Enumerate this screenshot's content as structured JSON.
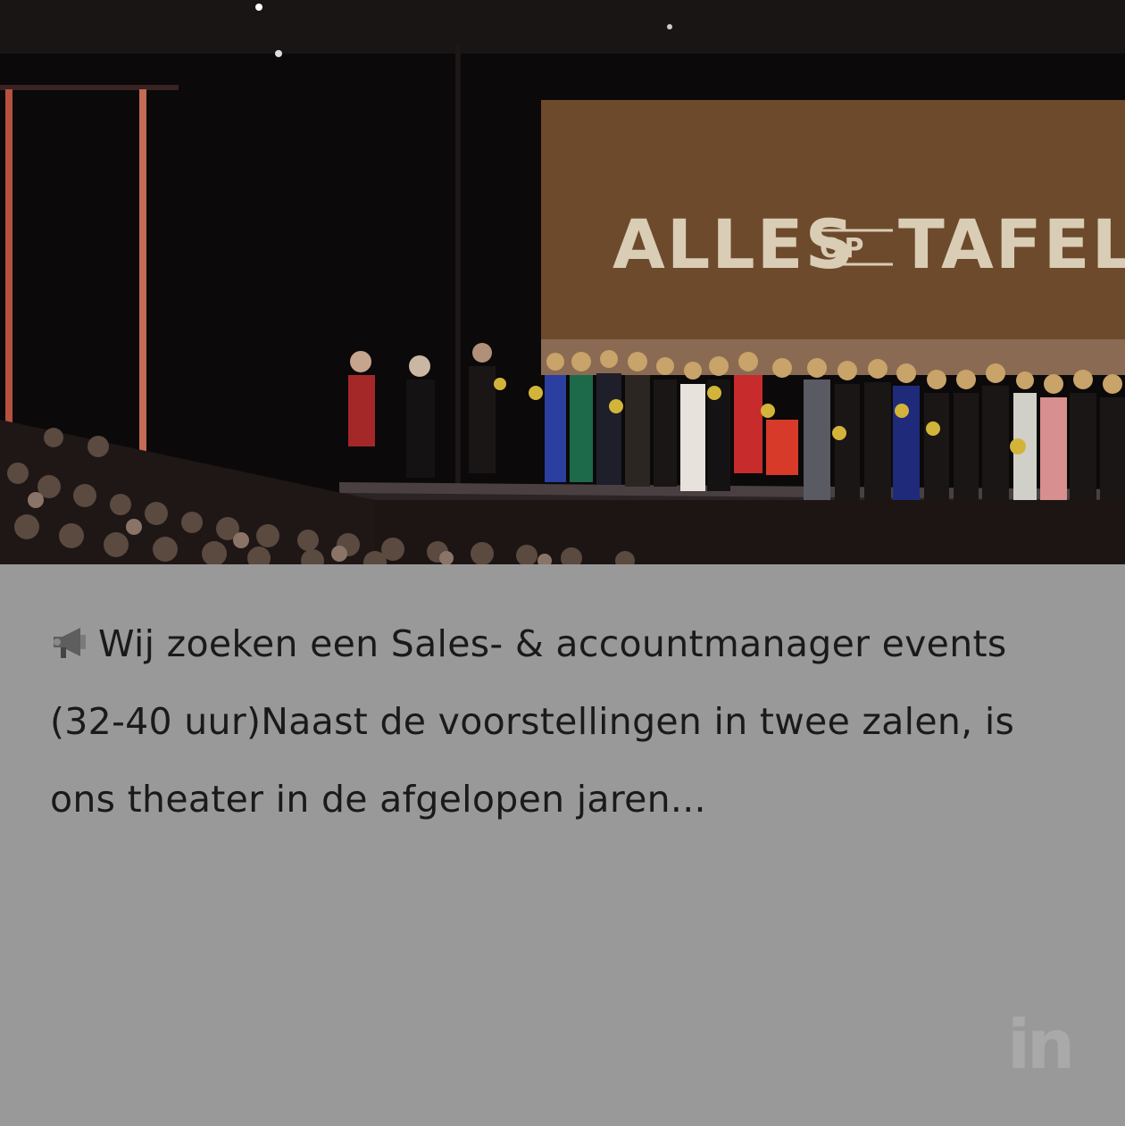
{
  "post": {
    "image": {
      "alt": "",
      "banner_word_left": "ALLES",
      "banner_word_small": "OP",
      "banner_word_right": "TAFEL"
    },
    "text": "Wij zoeken een Sales- & accountmanager events (32-40 uur)Naast de voorstellingen in twee zalen, is ons theater in de afgelopen jaren...",
    "icon": "megaphone-icon",
    "source_icon": "linkedin-icon",
    "source_label": "in"
  },
  "colors": {
    "card_background": "#999999",
    "text": "#1a1a1a",
    "banner": "#6e4a2c"
  }
}
